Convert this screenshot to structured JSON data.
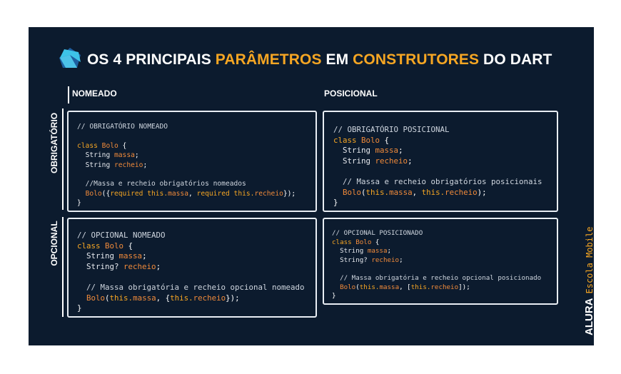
{
  "title": {
    "part1": "OS 4 PRINCIPAIS ",
    "part2": "PARÂMETROS",
    "part3": " EM ",
    "part4": "CONSTRUTORES",
    "part5": " DO DART"
  },
  "columns": {
    "named": "NOMEADO",
    "positional": "POSICIONAL"
  },
  "rows": {
    "required": "OBRIGATÓRIO",
    "optional": "OPCIONAL"
  },
  "boxes": {
    "required_named": {
      "comment": "// OBRIGATÓRIO NOMEADO",
      "class_kw": "class",
      "class_name": "Bolo",
      "open": " {",
      "type1": "String",
      "field1": "massa",
      "semi1": ";",
      "type2": "String",
      "field2": "recheio",
      "semi2": ";",
      "note": "//Massa e recheio obrigatórios nomeados",
      "ctor": "Bolo",
      "args_a": "({",
      "req1": "required",
      "this1": " this.",
      "f1": "massa",
      "comma": ", ",
      "req2": "required",
      "this2": " this.",
      "f2": "recheio",
      "args_b": "});",
      "close": "}"
    },
    "required_positional": {
      "comment": "// OBRIGATÓRIO POSICIONAL",
      "class_kw": "class",
      "class_name": "Bolo",
      "open": " {",
      "type1": "String",
      "field1": "massa",
      "semi1": ";",
      "type2": "String",
      "field2": "recheio",
      "semi2": ";",
      "note": "// Massa e recheio obrigatórios posicionais",
      "ctor": "Bolo",
      "args_a": "(",
      "this1": "this.",
      "f1": "massa",
      "comma": ", ",
      "this2": "this.",
      "f2": "recheio",
      "args_b": ");",
      "close": "}"
    },
    "optional_named": {
      "comment": "// OPCIONAL NOMEADO",
      "class_kw": "class",
      "class_name": "Bolo",
      "open": " {",
      "type1": "String",
      "field1": "massa",
      "semi1": ";",
      "type2": "String?",
      "field2": "recheio",
      "semi2": ";",
      "note": "// Massa obrigatória e recheio opcional nomeado",
      "ctor": "Bolo",
      "args_a": "(",
      "this1": "this.",
      "f1": "massa",
      "comma": ", {",
      "this2": "this.",
      "f2": "recheio",
      "args_b": "});",
      "close": "}"
    },
    "optional_positional": {
      "comment": "// OPCIONAL POSICIONADO",
      "class_kw": "class",
      "class_name": "Bolo",
      "open": " {",
      "type1": "String",
      "field1": "massa",
      "semi1": ";",
      "type2": "String?",
      "field2": "recheio",
      "semi2": ";",
      "note": "// Massa obrigatória e recheio opcional posicionado",
      "ctor": "Bolo",
      "args_a": "(",
      "this1": "this.",
      "f1": "massa",
      "comma": ", [",
      "this2": "this.",
      "f2": "recheio",
      "args_b": "]);",
      "close": "}"
    }
  },
  "brand": {
    "name": "ALURA",
    "tagline": "Escola Mobile"
  },
  "colors": {
    "background": "#0c1b2e",
    "accent": "#f6a623",
    "field": "#f08a3a",
    "logo_light": "#3dc3e8",
    "logo_dark": "#1d5fa0"
  }
}
